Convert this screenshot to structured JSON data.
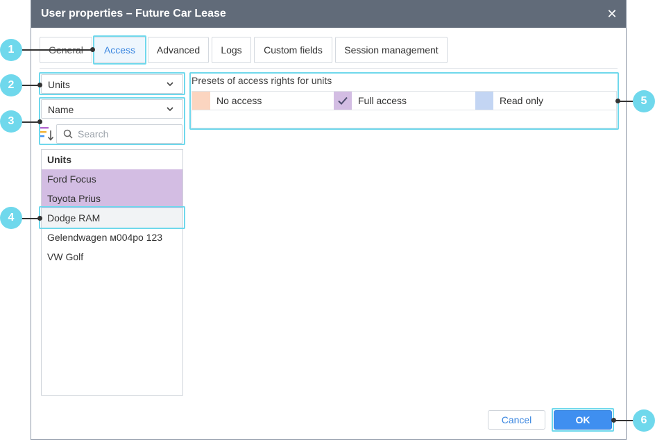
{
  "window": {
    "title": "User properties – Future Car Lease",
    "close_glyph": "✕"
  },
  "tabs": [
    {
      "label": "General"
    },
    {
      "label": "Access"
    },
    {
      "label": "Advanced"
    },
    {
      "label": "Logs"
    },
    {
      "label": "Custom fields"
    },
    {
      "label": "Session management"
    }
  ],
  "filters": {
    "type_select": "Units",
    "sort_select": "Name",
    "search_placeholder": "Search"
  },
  "list": {
    "header": "Units",
    "items": [
      "Ford Focus",
      "Toyota Prius",
      "Dodge RAM",
      "Gelendwagen м004ро 123",
      "VW Golf"
    ]
  },
  "presets": {
    "title": "Presets of access rights for units",
    "items": [
      {
        "label": "No access",
        "color": "#fbd5c0"
      },
      {
        "label": "Full access",
        "color": "#d3bde3"
      },
      {
        "label": "Read only",
        "color": "#c3d5f3"
      }
    ]
  },
  "buttons": {
    "cancel": "Cancel",
    "ok": "OK"
  },
  "callouts": [
    "1",
    "2",
    "3",
    "4",
    "5",
    "6"
  ],
  "colors": {
    "accent": "#3f8ff0",
    "highlight": "#6fd8ec",
    "titlebar": "#616b79"
  }
}
